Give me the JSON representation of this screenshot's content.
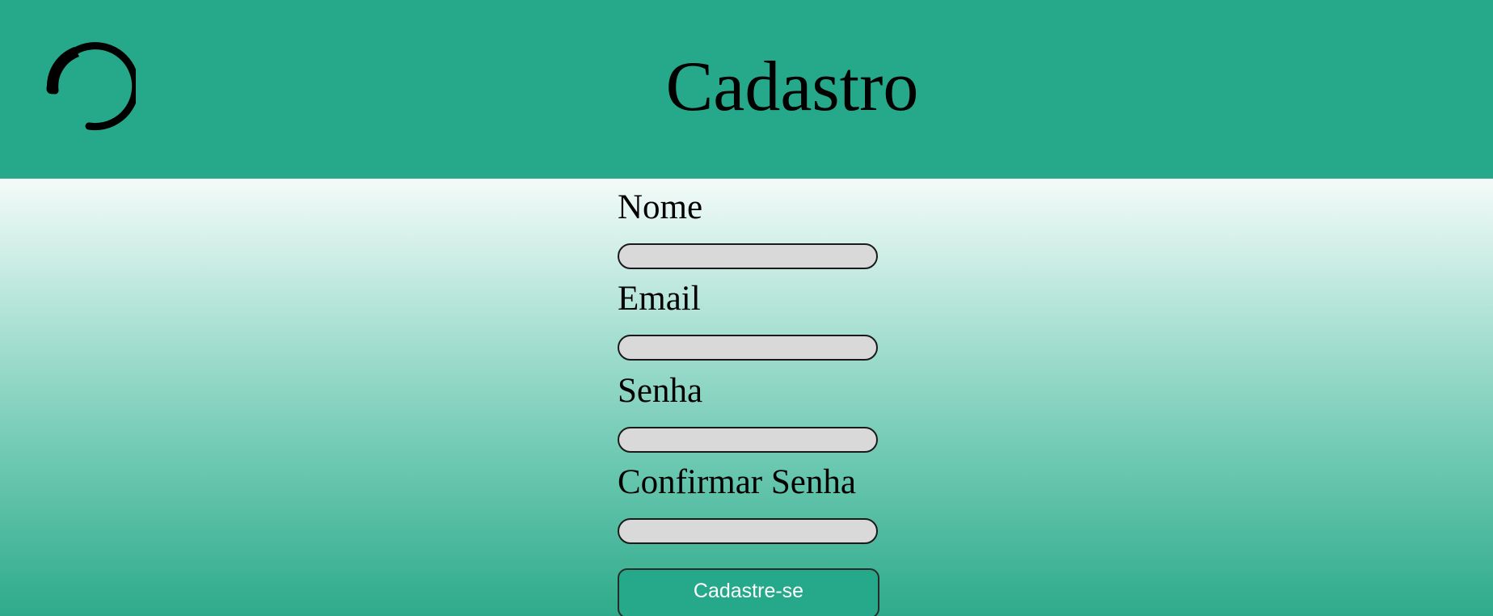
{
  "header": {
    "title": "Cadastro",
    "logo_icon": "loading-circle-icon",
    "background_color": "#26a98a"
  },
  "form": {
    "fields": [
      {
        "label": "Nome",
        "value": ""
      },
      {
        "label": "Email",
        "value": ""
      },
      {
        "label": "Senha",
        "value": ""
      },
      {
        "label": "Confirmar Senha",
        "value": ""
      }
    ],
    "submit_label": "Cadastre-se",
    "input_background": "#d9d9d9",
    "button_color": "#26a98a"
  }
}
